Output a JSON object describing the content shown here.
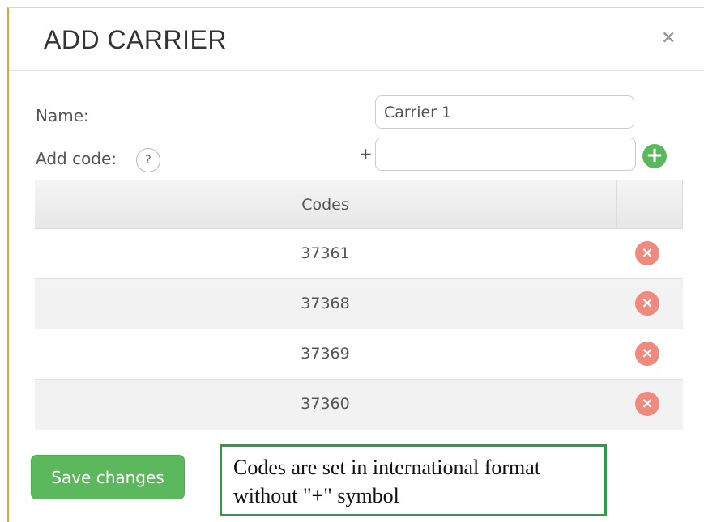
{
  "dialog": {
    "title": "ADD CARRIER",
    "close_icon": "close-icon"
  },
  "form": {
    "name_label": "Name:",
    "name_value": "Carrier 1",
    "add_code_label": "Add code:",
    "help_icon_glyph": "?",
    "code_prefix": "+",
    "code_value": "",
    "add_icon_glyph": "+"
  },
  "table": {
    "header": "Codes",
    "rows": [
      {
        "code": "37361"
      },
      {
        "code": "37368"
      },
      {
        "code": "37369"
      },
      {
        "code": "37360"
      }
    ],
    "remove_icon_glyph": "×"
  },
  "footer": {
    "save_label": "Save changes"
  },
  "annotation": {
    "line1": "Codes are set in international format",
    "line2": "without \"+\" symbol"
  },
  "colors": {
    "accent_green": "#5cb85c",
    "remove_red": "#ef8a7e",
    "note_border": "#2e9b48",
    "modal_left_border": "#e8a23a"
  }
}
